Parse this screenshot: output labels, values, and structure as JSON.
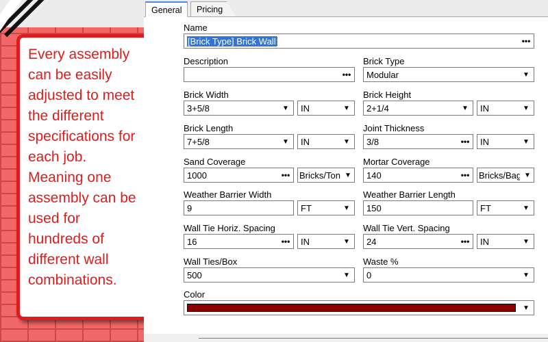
{
  "callout": {
    "lines": [
      "Every assembly",
      "can be easily",
      "adjusted to meet",
      "the different",
      "specifications for",
      "each job.",
      "Meaning one",
      "assembly can be",
      "used for",
      "hundreds of",
      "different wall",
      "combinations."
    ],
    "color": "#e11b1b"
  },
  "tabs": {
    "general": "General",
    "pricing": "Pricing"
  },
  "form": {
    "name": {
      "label": "Name",
      "value": "[Brick Type] Brick Wall"
    },
    "description": {
      "label": "Description",
      "value": ""
    },
    "brick_type": {
      "label": "Brick Type",
      "value": "Modular"
    },
    "brick_width": {
      "label": "Brick Width",
      "value": "3+5/8",
      "unit": "IN"
    },
    "brick_height": {
      "label": "Brick Height",
      "value": "2+1/4",
      "unit": "IN"
    },
    "brick_length": {
      "label": "Brick Length",
      "value": "7+5/8",
      "unit": "IN"
    },
    "joint_thickness": {
      "label": "Joint Thickness",
      "value": "3/8",
      "unit": "IN"
    },
    "sand_coverage": {
      "label": "Sand Coverage",
      "value": "1000",
      "unit": "Bricks/Ton"
    },
    "mortar_coverage": {
      "label": "Mortar Coverage",
      "value": "140",
      "unit": "Bricks/Bag"
    },
    "wb_width": {
      "label": "Weather Barrier Width",
      "value": "9",
      "unit": "FT"
    },
    "wb_length": {
      "label": "Weather Barrier Length",
      "value": "150",
      "unit": "FT"
    },
    "tie_horiz": {
      "label": "Wall Tie Horiz. Spacing",
      "value": "16",
      "unit": "IN"
    },
    "tie_vert": {
      "label": "Wall Tie Vert. Spacing",
      "value": "24",
      "unit": "IN"
    },
    "ties_box": {
      "label": "Wall Ties/Box",
      "value": "500"
    },
    "waste": {
      "label": "Waste %",
      "value": "0"
    },
    "color": {
      "label": "Color",
      "swatch": "#8b0000"
    }
  },
  "icons": {
    "ellipsis": "•••",
    "dropdown": "▼"
  }
}
